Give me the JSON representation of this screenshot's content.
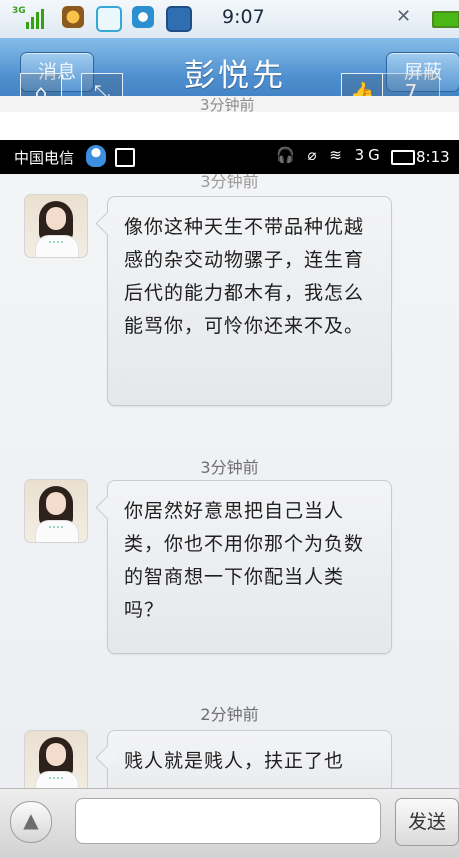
{
  "app_frame": {
    "status": {
      "time": "9:07",
      "network": "3G"
    },
    "title": "彭悦先",
    "left_button": "消息",
    "right_button": "屏蔽",
    "overlay_icons": [
      "home-icon",
      "expand-icon",
      "thumb-up-icon"
    ],
    "overlay_number": "7",
    "peek_text": "3分钟前"
  },
  "device_status": {
    "carrier": "中国电信",
    "time": "8:13",
    "icons_text": "🎧 ⌀ ≋ 3G"
  },
  "chat": {
    "top_cut_label": "3分钟前",
    "messages": [
      {
        "time": null,
        "text": "像你这种天生不带品种优越感的杂交动物骡子，连生育后代的能力都木有，我怎么能骂你，可怜你还来不及。"
      },
      {
        "time": "3分钟前",
        "text": "你居然好意思把自己当人类，你也不用你那个为负数的智商想一下你配当人类吗？"
      },
      {
        "time": "2分钟前",
        "text": "贱人就是贱人，扶正了也"
      }
    ]
  },
  "input_bar": {
    "input_value": "",
    "input_placeholder": "",
    "send_label": "发送"
  },
  "colors": {
    "titlebar_blue": "#4e8fcf",
    "bubble_bg": "#e5e7ea",
    "status_black": "#000000"
  }
}
